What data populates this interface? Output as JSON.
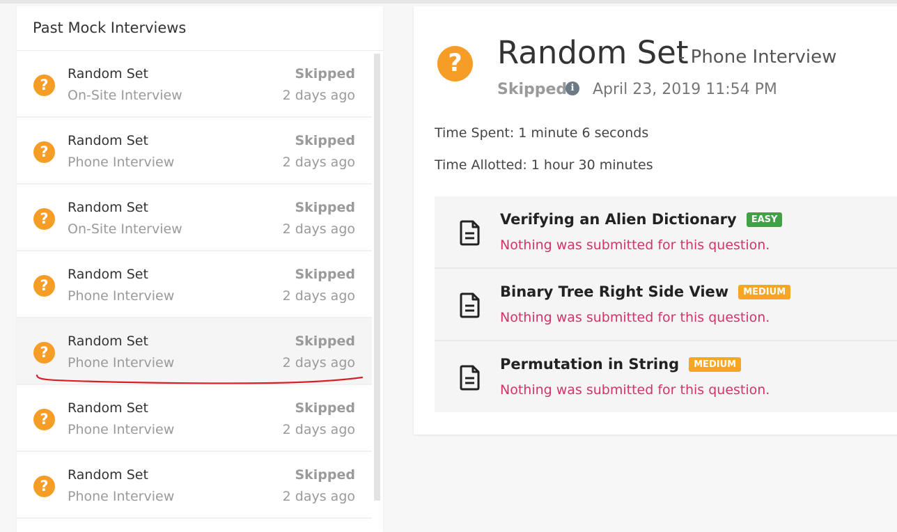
{
  "left": {
    "header": "Past Mock Interviews",
    "items": [
      {
        "title": "Random Set",
        "subtitle": "On-Site Interview",
        "status": "Skipped",
        "time": "2 days ago"
      },
      {
        "title": "Random Set",
        "subtitle": "Phone Interview",
        "status": "Skipped",
        "time": "2 days ago"
      },
      {
        "title": "Random Set",
        "subtitle": "On-Site Interview",
        "status": "Skipped",
        "time": "2 days ago"
      },
      {
        "title": "Random Set",
        "subtitle": "Phone Interview",
        "status": "Skipped",
        "time": "2 days ago"
      },
      {
        "title": "Random Set",
        "subtitle": "Phone Interview",
        "status": "Skipped",
        "time": "2 days ago"
      },
      {
        "title": "Random Set",
        "subtitle": "Phone Interview",
        "status": "Skipped",
        "time": "2 days ago"
      },
      {
        "title": "Random Set",
        "subtitle": "Phone Interview",
        "status": "Skipped",
        "time": "2 days ago"
      }
    ]
  },
  "detail": {
    "title": "Random Set",
    "subtitle": "- Phone Interview",
    "status": "Skipped",
    "date": "April 23, 2019 11:54 PM",
    "time_spent": "Time Spent: 1 minute 6 seconds",
    "time_allotted": "Time Allotted: 1 hour 30 minutes",
    "questions": [
      {
        "name": "Verifying an Alien Dictionary",
        "difficulty": "EASY",
        "note": "Nothing was submitted for this question."
      },
      {
        "name": "Binary Tree Right Side View",
        "difficulty": "MEDIUM",
        "note": "Nothing was submitted for this question."
      },
      {
        "name": "Permutation in String",
        "difficulty": "MEDIUM",
        "note": "Nothing was submitted for this question."
      }
    ]
  },
  "icons": {
    "status": "question-mark-icon",
    "info": "info-icon",
    "question": "document-icon"
  },
  "colors": {
    "skipped_icon": "#f69d28",
    "easy": "#43a047",
    "medium": "#f5a623",
    "note": "#d1346a",
    "annotation": "#d91f26"
  }
}
